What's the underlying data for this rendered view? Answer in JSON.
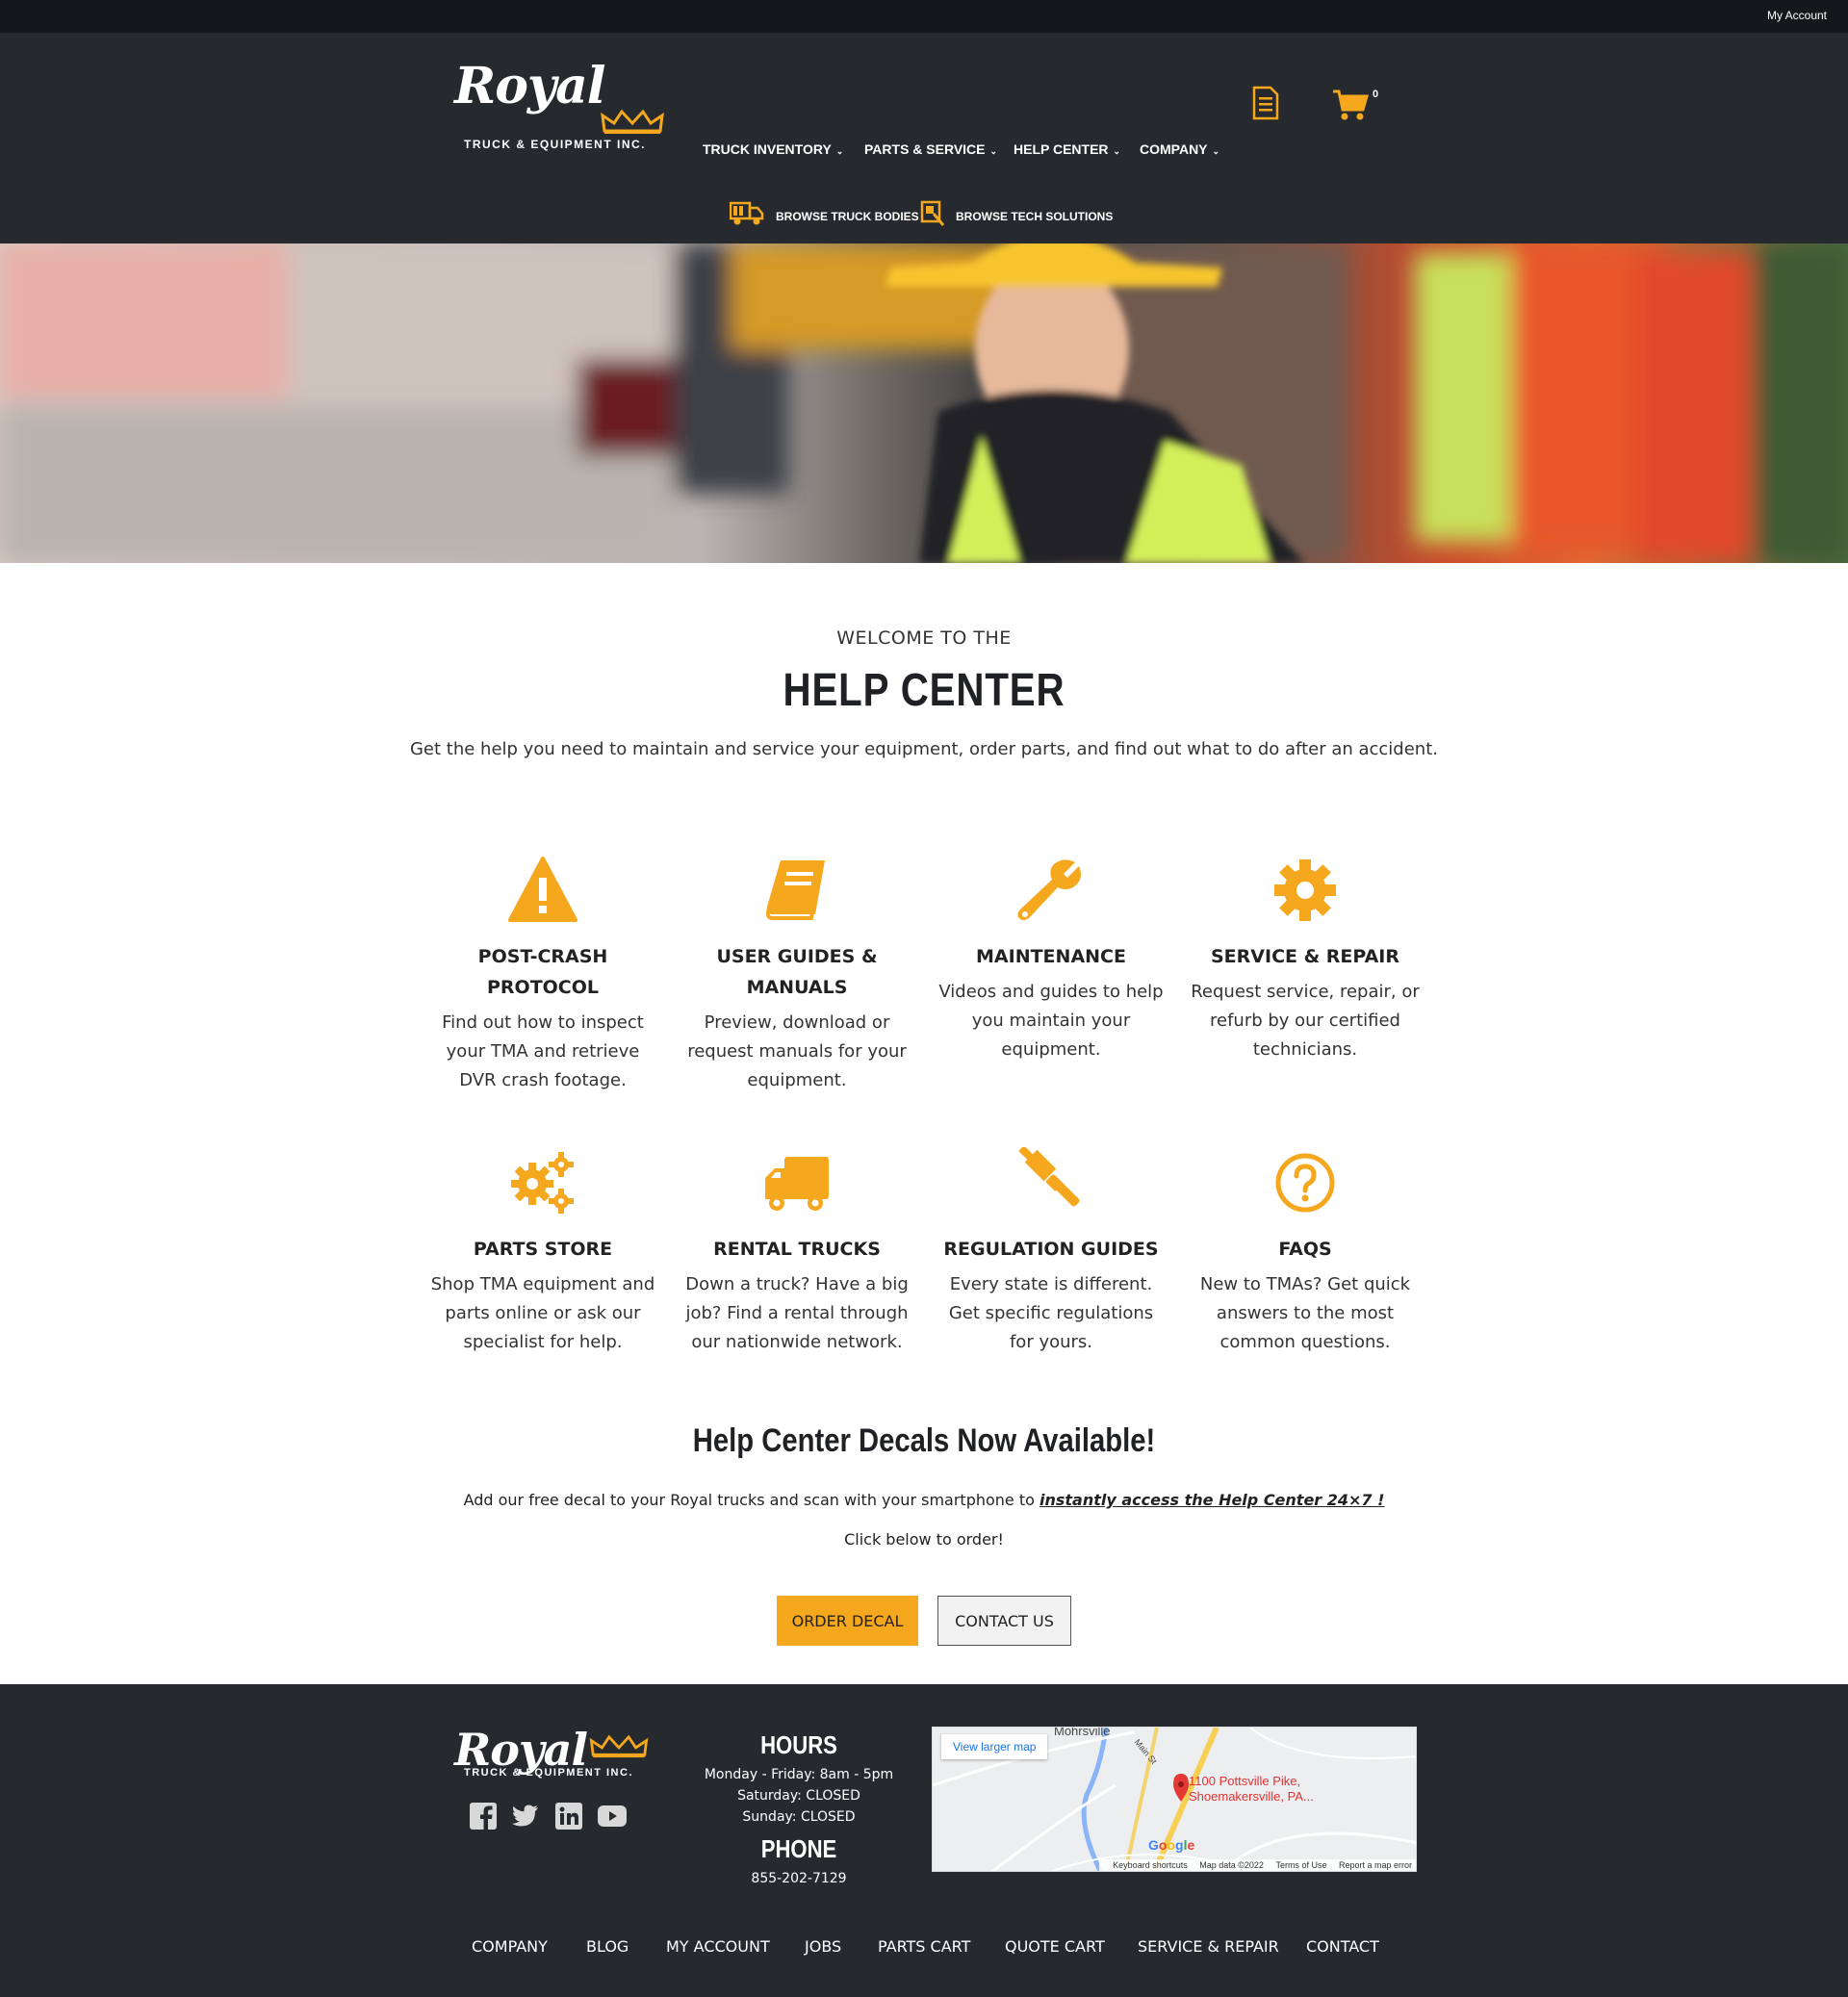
{
  "topbar": {
    "account_link": "My Account"
  },
  "brand": {
    "script": "Royal",
    "sub": "TRUCK & EQUIPMENT INC.",
    "crown_color": "#f5a71d"
  },
  "nav": {
    "items": [
      {
        "label": "TRUCK INVENTORY"
      },
      {
        "label": "PARTS & SERVICE"
      },
      {
        "label": "HELP CENTER"
      },
      {
        "label": "COMPANY"
      }
    ],
    "cart_count": "0",
    "browse": [
      {
        "label": "BROWSE TRUCK BODIES",
        "icon": "truck-body-icon"
      },
      {
        "label": "BROWSE TECH SOLUTIONS",
        "icon": "tech-solutions-icon"
      }
    ]
  },
  "intro": {
    "kicker": "WELCOME TO THE",
    "title": "HELP CENTER",
    "text": "Get the help you need to maintain and service your equipment, order parts, and find out what to do after an accident."
  },
  "cards": [
    {
      "icon": "warning-icon",
      "title": "POST-CRASH PROTOCOL",
      "text": "Find out how to inspect your TMA and retrieve DVR crash footage."
    },
    {
      "icon": "book-icon",
      "title": "USER GUIDES & MANUALS",
      "text": "Preview, download or request manuals for your equipment."
    },
    {
      "icon": "wrench-icon",
      "title": "MAINTENANCE",
      "text": "Videos and guides to help you maintain your equipment."
    },
    {
      "icon": "gear-icon",
      "title": "SERVICE & REPAIR",
      "text": "Request service, repair, or refurb by our certified technicians."
    },
    {
      "icon": "gears-icon",
      "title": "PARTS STORE",
      "text": "Shop TMA equipment and parts online or ask our specialist for help."
    },
    {
      "icon": "truck-icon",
      "title": "RENTAL TRUCKS",
      "text": "Down a truck? Have a big job? Find a rental through our nationwide network."
    },
    {
      "icon": "gavel-icon",
      "title": "REGULATION GUIDES",
      "text": "Every state is different. Get specific regulations for yours."
    },
    {
      "icon": "question-icon",
      "title": "FAQS",
      "text": "New to TMAs? Get quick answers to the most common questions."
    }
  ],
  "decals": {
    "title": "Help Center Decals Now Available!",
    "text_before": "Add our free decal to your Royal trucks and scan with your smartphone to ",
    "link_text": "instantly access the Help Center 24×7 !",
    "click": "Click below to order!",
    "order_button": "ORDER DECAL",
    "contact_button": "CONTACT US"
  },
  "footer": {
    "hours_title": "HOURS",
    "hours": [
      "Monday - Friday: 8am - 5pm",
      "Saturday: CLOSED",
      "Sunday: CLOSED"
    ],
    "phone_title": "PHONE",
    "phone": "855-202-7129",
    "map": {
      "view_larger": "View larger map",
      "address_line1": "1100 Pottsville Pike,",
      "address_line2": "Shoemakersville, PA...",
      "place_label": "Mohrsville",
      "street_label": "Main St",
      "google": "Google",
      "attribution": [
        "Keyboard shortcuts",
        "Map data ©2022",
        "Terms of Use",
        "Report a map error"
      ]
    },
    "links": [
      {
        "label": "COMPANY"
      },
      {
        "label": "BLOG"
      },
      {
        "label": "MY ACCOUNT"
      },
      {
        "label": "JOBS"
      },
      {
        "label": "PARTS CART"
      },
      {
        "label": "QUOTE CART"
      },
      {
        "label": "SERVICE & REPAIR"
      },
      {
        "label": "CONTACT"
      }
    ]
  },
  "colors": {
    "accent": "#f5a71d",
    "dark": "#262a2f",
    "topbar": "#15171a"
  }
}
